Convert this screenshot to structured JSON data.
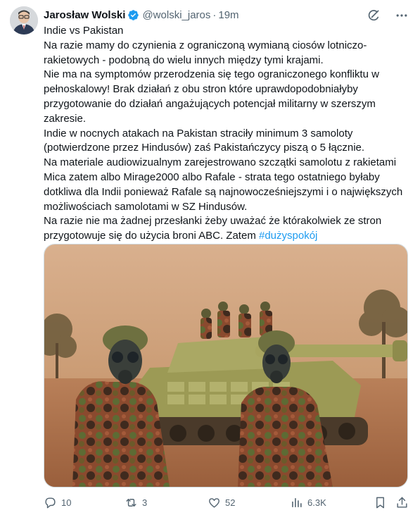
{
  "author": {
    "name": "Jarosław Wolski",
    "handle": "@wolski_jaros",
    "separator": "·",
    "time": "19m"
  },
  "tweet": {
    "paragraphs": [
      "Indie vs Pakistan",
      "Na razie mamy do czynienia z ograniczoną wymianą ciosów lotniczo-rakietowych - podobną do wielu innych między tymi krajami.",
      "Nie ma na symptomów przerodzenia się tego ograniczonego konfliktu w pełnoskalowy! Brak działań z obu stron które uprawdopodobniałyby przygotowanie do działań angażujących potencjał militarny w szerszym zakresie.",
      "Indie w nocnych atakach na Pakistan straciły minimum 3 samoloty (potwierdzone przez Hindusów) zaś Pakistańczycy piszą o 5 łącznie.",
      "Na materiale audiowizualnym zarejestrowano szczątki samolotu z rakietami Mica zatem albo Mirage2000 albo Rafale - strata tego ostatniego byłaby dotkliwa dla Indii ponieważ Rafale są najnowocześniejszymi i o największych możliwościach samolotami w SZ Hindusów."
    ],
    "last_paragraph": "Na razie nie ma żadnej przesłanki  żeby uważać że którakolwiek ze stron przygotowuje się do użycia broni ABC. Zatem ",
    "hashtag": "#dużyspokój"
  },
  "stats": {
    "replies": "10",
    "reposts": "3",
    "likes": "52",
    "views": "6.3K"
  },
  "icons": [
    "grok-icon",
    "more-icon",
    "reply-icon",
    "repost-icon",
    "like-icon",
    "views-icon",
    "bookmark-icon",
    "share-icon"
  ],
  "colors": {
    "text": "#0f1419",
    "secondary": "#536471",
    "accent": "#1d9bf0",
    "verified": "#1d9bf0"
  }
}
